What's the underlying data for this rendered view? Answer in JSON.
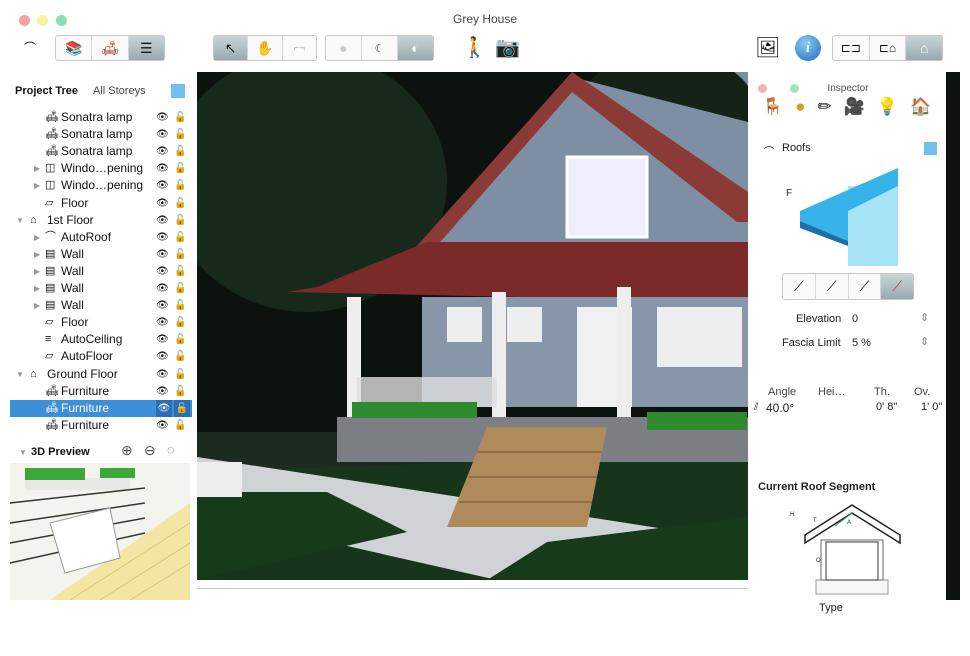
{
  "window": {
    "title": "Grey House",
    "controls": {
      "close": "#f3a3a3",
      "minimize": "#f6f2a0",
      "zoom": "#8fe0b0"
    }
  },
  "toolbar": {
    "left_icons": [
      "roof-tool-icon",
      "library-icon",
      "furniture-icon",
      "project-tree-icon"
    ],
    "tool_icons": [
      "pointer-icon",
      "hand-icon",
      "measure-icon"
    ],
    "view_icons": [
      "sphere-light-icon",
      "moon-icon",
      "eclipse-icon"
    ],
    "extra_icons": [
      "walk-icon",
      "camera-icon"
    ],
    "right_icons": [
      "media-browser-icon",
      "info-icon",
      "2d-plan-icon",
      "split-view-icon",
      "3d-view-icon"
    ]
  },
  "sidebar": {
    "tab_project_tree": "Project Tree",
    "tab_all_storeys": "All Storeys",
    "items": [
      {
        "label": "Sonatra lamp",
        "icon": "lamp-icon",
        "level": 2,
        "expander": ""
      },
      {
        "label": "Sonatra lamp",
        "icon": "lamp-icon",
        "level": 2,
        "expander": ""
      },
      {
        "label": "Sonatra lamp",
        "icon": "lamp-icon",
        "level": 2,
        "expander": ""
      },
      {
        "label": "Windo…pening",
        "icon": "window-icon",
        "level": 2,
        "expander": "▶"
      },
      {
        "label": "Windo…pening",
        "icon": "window-icon",
        "level": 2,
        "expander": "▶"
      },
      {
        "label": "Floor",
        "icon": "floor-icon",
        "level": 2,
        "expander": ""
      },
      {
        "label": "1st Floor",
        "icon": "storey-icon",
        "level": 1,
        "expander": "▼"
      },
      {
        "label": "AutoRoof",
        "icon": "roof-icon",
        "level": 2,
        "expander": "▶"
      },
      {
        "label": "Wall",
        "icon": "wall-icon",
        "level": 2,
        "expander": "▶"
      },
      {
        "label": "Wall",
        "icon": "wall-icon",
        "level": 2,
        "expander": "▶"
      },
      {
        "label": "Wall",
        "icon": "wall-icon",
        "level": 2,
        "expander": "▶"
      },
      {
        "label": "Wall",
        "icon": "wall-icon",
        "level": 2,
        "expander": "▶"
      },
      {
        "label": "Floor",
        "icon": "floor-icon",
        "level": 2,
        "expander": ""
      },
      {
        "label": "AutoCeiling",
        "icon": "ceiling-icon",
        "level": 2,
        "expander": ""
      },
      {
        "label": "AutoFloor",
        "icon": "floor-icon",
        "level": 2,
        "expander": ""
      },
      {
        "label": "Ground Floor",
        "icon": "storey-icon",
        "level": 1,
        "expander": "▼"
      },
      {
        "label": "Furniture",
        "icon": "furniture-icon",
        "level": 2,
        "expander": ""
      },
      {
        "label": "Furniture",
        "icon": "furniture-icon",
        "level": 2,
        "expander": "",
        "selected": true
      },
      {
        "label": "Furniture",
        "icon": "furniture-icon",
        "level": 2,
        "expander": ""
      }
    ]
  },
  "preview": {
    "title": "3D Preview"
  },
  "inspector": {
    "title": "Inspector",
    "section": "Roofs",
    "preview_letter": "F",
    "elevation_label": "Elevation",
    "elevation_value": "0",
    "fascia_label": "Fascia Limit",
    "fascia_value": "5 %",
    "col_angle": "Angle",
    "col_height": "Hei…",
    "col_th": "Th.",
    "col_ov": "Ov.",
    "angle_value": "40.0°",
    "th_value": "0' 8\"",
    "ov_value": "1' 0\"",
    "segment_title": "Current Roof Segment",
    "diagram_labels": {
      "h": "H",
      "t": "T",
      "a": "A",
      "o": "O"
    },
    "type_label": "Type"
  }
}
